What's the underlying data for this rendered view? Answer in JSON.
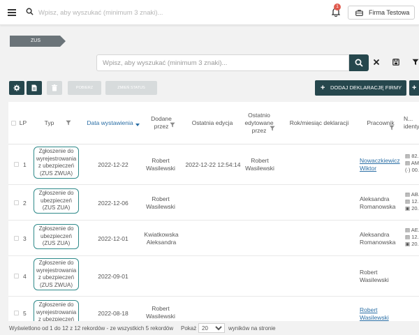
{
  "header": {
    "search_placeholder": "Wpisz, aby wyszukać (minimum 3 znaki)...",
    "notification_count": "1",
    "company": "Firma Testowa"
  },
  "breadcrumb": "ZUS",
  "search": {
    "placeholder": "Wpisz, aby wyszukać (minimum 3 znaki)..."
  },
  "toolbar": {
    "btn_pobierz": "POBIERZ",
    "btn_zmien_status": "ZMIEŃ STATUS",
    "add_declaration": "DODAJ DEKLARACJĘ FIRMY",
    "add_symbol": "+"
  },
  "table": {
    "columns": {
      "lp": "LP",
      "typ": "Typ",
      "data": "Data wystawienia",
      "dodane": "Dodane przez",
      "edycja": "Ostatnia edycja",
      "edytowane": "Ostatnio edytowane przez",
      "rok": "Rok/miesiąc deklaracji",
      "pracownik": "Pracownik",
      "ident": "N... identy..."
    },
    "rows": [
      {
        "lp": "1",
        "typ": "Zgłoszenie do wyrejestrowania z ubezpieczeń (ZUS ZWUA)",
        "data": "2022-12-22",
        "dodane": "Robert Wasilewski",
        "edycja": "2022-12-22 12:54:14",
        "edytowane": "Robert Wasilewski",
        "pracownik": "Nowaczkiewicz Wiktor",
        "ident": [
          "82...",
          "AM...",
          "00..."
        ]
      },
      {
        "lp": "2",
        "typ": "Zgłoszenie do ubezpieczeń (ZUS ZUA)",
        "data": "2022-12-06",
        "dodane": "Robert Wasilewski",
        "edycja": "",
        "edytowane": "",
        "pracownik": "Aleksandra Romanowska",
        "ident": [
          "AB...",
          "12...",
          "20..."
        ]
      },
      {
        "lp": "3",
        "typ": "Zgłoszenie do ubezpieczeń (ZUS ZUA)",
        "data": "2022-12-01",
        "dodane": "Kwiatkowska Aleksandra",
        "edycja": "",
        "edytowane": "",
        "pracownik": "Aleksandra Romanowska",
        "ident": [
          "AE...",
          "12...",
          "20..."
        ]
      },
      {
        "lp": "4",
        "typ": "Zgłoszenie do wyrejestrowania z ubezpieczeń (ZUS ZWUA)",
        "data": "2022-09-01",
        "dodane": "",
        "edycja": "",
        "edytowane": "",
        "pracownik": "Robert Wasilewski",
        "ident": []
      },
      {
        "lp": "5",
        "typ": "Zgłoszenie do wyrejestrowania z ubezpieczeń",
        "data": "2022-08-18",
        "dodane": "Robert Wasilewski",
        "edycja": "",
        "edytowane": "",
        "pracownik": "Robert Wasilewski",
        "ident": []
      }
    ]
  },
  "footer": {
    "info": "Wyświetlono od 1 do 12 z 12 rekordów - ze wszystkich 5 rekordów",
    "show_label": "Pokaż",
    "page_size": "20",
    "per_page_label": "wyników na stronie"
  },
  "colors": {
    "primary": "#26474d",
    "link": "#2a6ea5",
    "badge": "#e05a4e",
    "tag_border": "#2f8a8a"
  }
}
